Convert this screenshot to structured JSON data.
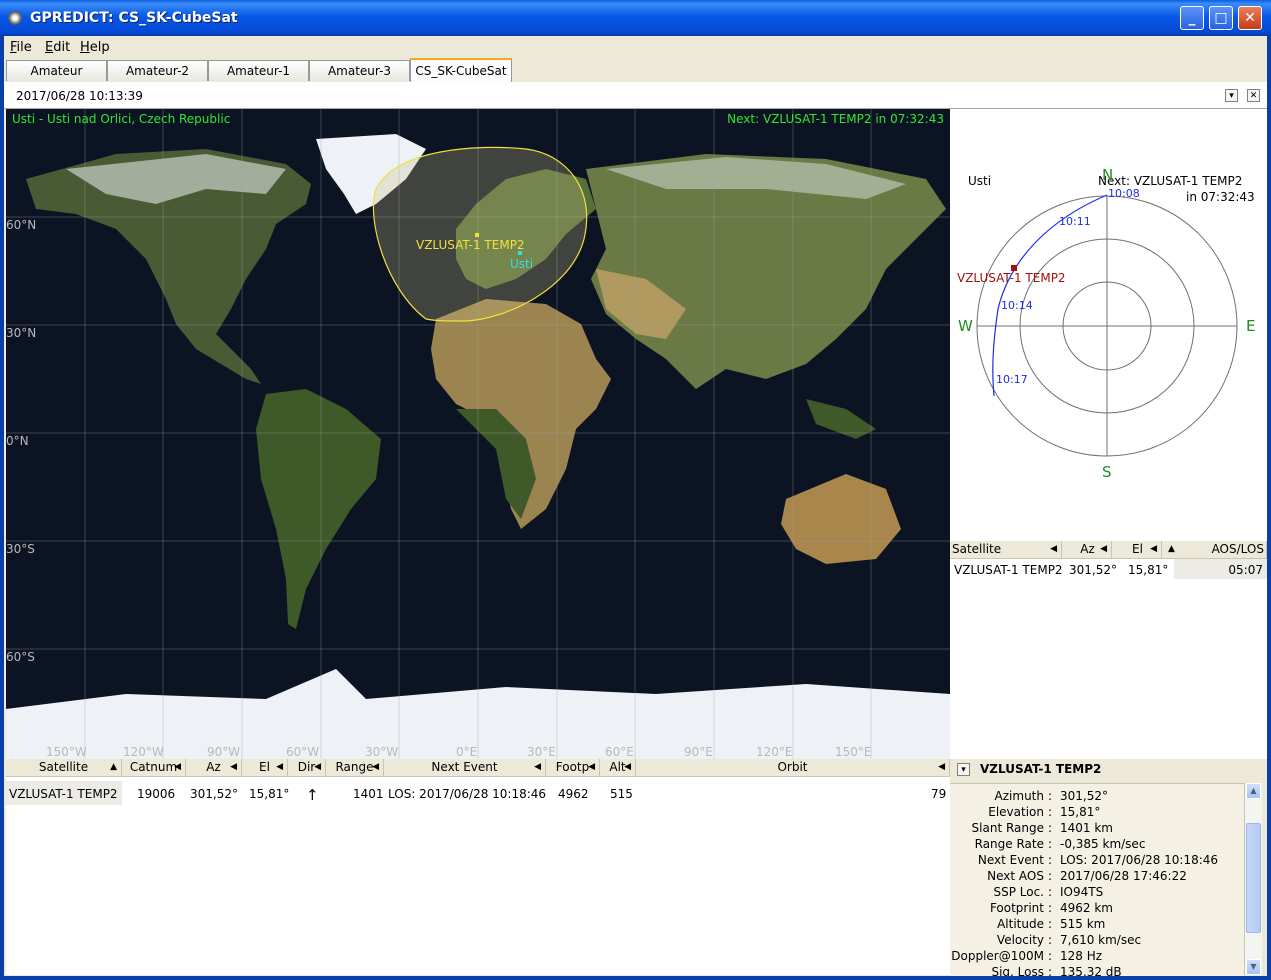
{
  "window": {
    "title": "GPREDICT: CS_SK-CubeSat",
    "minimize": "_",
    "maximize": "□",
    "close": "✕"
  },
  "menu": [
    {
      "label": "File",
      "key": "F",
      "rest": "ile"
    },
    {
      "label": "Edit",
      "key": "E",
      "rest": "dit"
    },
    {
      "label": "Help",
      "key": "H",
      "rest": "elp"
    }
  ],
  "tabs": [
    "Amateur",
    "Amateur-2",
    "Amateur-1",
    "Amateur-3",
    "CS_SK-CubeSat"
  ],
  "datebar": {
    "datetime": "2017/06/28 10:13:39"
  },
  "map": {
    "location": "Usti - Usti nad Orlici, Czech Republic",
    "next": "Next: VZLUSAT-1 TEMP2 in 07:32:43",
    "lat_labels": [
      "60°N",
      "30°N",
      "0°N",
      "30°S",
      "60°S"
    ],
    "lon_labels": [
      "150°W",
      "120°W",
      "90°W",
      "60°W",
      "30°W",
      "0°E",
      "30°E",
      "60°E",
      "90°E",
      "120°E",
      "150°E"
    ],
    "satellite": "VZLUSAT-1 TEMP2",
    "station": "Usti"
  },
  "polar": {
    "station": "Usti",
    "next_line1": "Next: VZLUSAT-1 TEMP2",
    "next_line2": "in 07:32:43",
    "n": "N",
    "e": "E",
    "s": "S",
    "w": "W",
    "satellite": "VZLUSAT-1 TEMP2",
    "times": [
      "10:08",
      "10:11",
      "10:14",
      "10:17"
    ]
  },
  "sat_list": {
    "headers": [
      "Satellite",
      "Az",
      "El",
      "AOS/LOS"
    ],
    "row": {
      "name": "VZLUSAT-1 TEMP2",
      "az": "301,52°",
      "el": "15,81°",
      "aos": "05:07"
    }
  },
  "table": {
    "headers": [
      "Satellite",
      "Catnum",
      "Az",
      "El",
      "Dir",
      "Range",
      "Next Event",
      "Footp",
      "Alt",
      "Orbit"
    ],
    "row": {
      "name": "VZLUSAT-1 TEMP2",
      "catnum": "19006",
      "az": "301,52°",
      "el": "15,81°",
      "dir": "↑",
      "range": "1401",
      "next_event": "LOS: 2017/06/28 10:18:46",
      "footp": "4962",
      "alt": "515",
      "orbit": "79"
    }
  },
  "info": {
    "title": "VZLUSAT-1 TEMP2",
    "rows": [
      {
        "k": "Azimuth",
        "v": "301,52°"
      },
      {
        "k": "Elevation",
        "v": "15,81°"
      },
      {
        "k": "Slant Range",
        "v": "1401 km"
      },
      {
        "k": "Range Rate",
        "v": "-0,385 km/sec"
      },
      {
        "k": "Next Event",
        "v": "LOS: 2017/06/28 10:18:46"
      },
      {
        "k": "Next AOS",
        "v": "2017/06/28 17:46:22"
      },
      {
        "k": "SSP Loc.",
        "v": "IO94TS"
      },
      {
        "k": "Footprint",
        "v": "4962 km"
      },
      {
        "k": "Altitude",
        "v": "515 km"
      },
      {
        "k": "Velocity",
        "v": "7,610 km/sec"
      },
      {
        "k": "Doppler@100M",
        "v": "128 Hz"
      },
      {
        "k": "Sig. Loss",
        "v": "135,32 dB"
      }
    ]
  },
  "colors": {
    "map_text": "#32e632",
    "footprint": "#f0e040",
    "station": "#30e0e0",
    "track": "#1a2ee6",
    "sat_marker": "#a01010",
    "compass": "#1e8c1e"
  }
}
